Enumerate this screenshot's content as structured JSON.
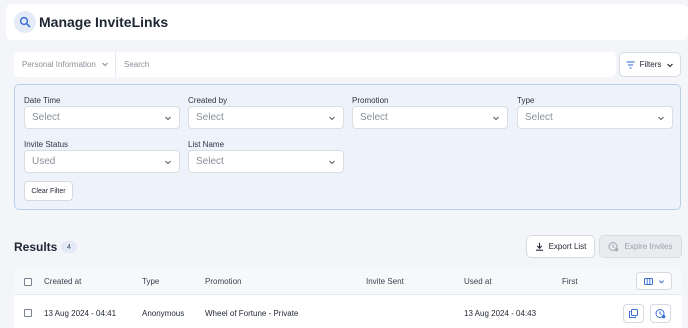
{
  "header": {
    "title": "Manage InviteLinks",
    "icon": "search-icon"
  },
  "search": {
    "category": "Personal Information",
    "placeholder": "Search",
    "value": ""
  },
  "filters_button": {
    "label": "Filters"
  },
  "filters": {
    "date_time": {
      "label": "Date Time",
      "value": "Select"
    },
    "created_by": {
      "label": "Created by",
      "value": "Select"
    },
    "promotion": {
      "label": "Promotion",
      "value": "Select"
    },
    "type": {
      "label": "Type",
      "value": "Select"
    },
    "invite_status": {
      "label": "Invite Status",
      "value": "Used"
    },
    "list_name": {
      "label": "List Name",
      "value": "Select"
    },
    "clear_label": "Clear Filter"
  },
  "results": {
    "title": "Results",
    "count": "4",
    "export_label": "Export List",
    "expire_label": "Expire Invites"
  },
  "table": {
    "columns": [
      "Created at",
      "Type",
      "Promotion",
      "Invite Sent",
      "Used at",
      "First"
    ],
    "rows": [
      {
        "created_at": "13 Aug 2024 - 04:41",
        "type": "Anonymous",
        "promotion": "Wheel of Fortune - Private",
        "invite_sent": "",
        "used_at": "13 Aug 2024 - 04:43"
      }
    ]
  },
  "colors": {
    "accent": "#3b6fd4",
    "panel_bg": "#eef3fb",
    "panel_border": "#b8d0ec"
  }
}
